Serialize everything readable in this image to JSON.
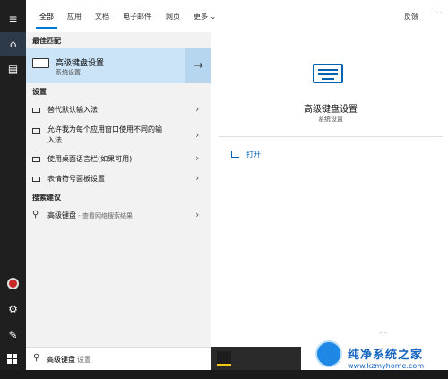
{
  "background_window": {
    "title": ""
  },
  "tabs": [
    {
      "label": "全部"
    },
    {
      "label": "应用"
    },
    {
      "label": "文档"
    },
    {
      "label": "电子邮件"
    },
    {
      "label": "网页"
    },
    {
      "label": "更多"
    }
  ],
  "toolbar": {
    "feedback_label": "反馈",
    "more_options": "···"
  },
  "sections": {
    "best_match": "最佳匹配",
    "settings": "设置",
    "web_suggestions": "搜索建议"
  },
  "best_match": {
    "title": "高级键盘设置",
    "subtitle": "系统设置"
  },
  "settings_items": [
    {
      "label": "替代默认输入法"
    },
    {
      "label_line1": "允许我为每个应用窗口使用不同的输",
      "label_line2": "入法"
    },
    {
      "label": "使用桌面语言栏(如果可用)"
    },
    {
      "label": "表情符号面板设置"
    }
  ],
  "web_item": {
    "query": "高级键盘",
    "hint": " - 查看网络搜索结果"
  },
  "preview": {
    "title": "高级键盘设置",
    "subtitle": "系统设置",
    "open_label": "打开"
  },
  "search_box": {
    "query": "高级键盘",
    "completion": "设置"
  },
  "watermark": {
    "text": "纯净系统之家",
    "url": "www.kzmyhome.com"
  },
  "colors": {
    "accent": "#0078d7",
    "selection": "#cce4f7",
    "rail": "#1f1f1f"
  }
}
